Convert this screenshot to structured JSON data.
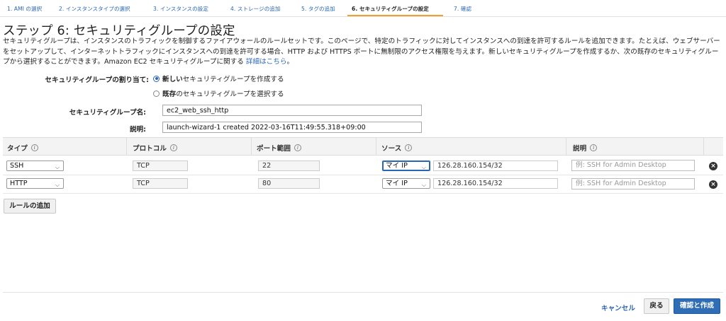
{
  "wizard": {
    "tabs": [
      {
        "label": "1. AMI の選択"
      },
      {
        "label": "2. インスタンスタイプの選択"
      },
      {
        "label": "3. インスタンスの設定"
      },
      {
        "label": "4. ストレージの追加"
      },
      {
        "label": "5. タグの追加"
      },
      {
        "label": "6. セキュリティグループの設定"
      },
      {
        "label": "7. 確認"
      }
    ],
    "active_index": 5
  },
  "page": {
    "title": "ステップ 6: セキュリティグループの設定",
    "intro": "セキュリティグループは、インスタンスのトラフィックを制御するファイアウォールのルールセットです。このページで、特定のトラフィックに対してインスタンスへの到達を許可するルールを追加できます。たとえば、ウェブサーバーをセットアップして、インターネットトラフィックにインスタンスへの到達を許可する場合、HTTP および HTTPS ポートに無制限のアクセス権限を与えます。新しいセキュリティグループを作成するか、次の既存のセキュリティグループから選択することができます。Amazon EC2 セキュリティグループに関する",
    "intro_link": "詳細はこちら",
    "intro_end": "。"
  },
  "assign": {
    "label": "セキュリティグループの割り当て:",
    "option_new_bold": "新しい",
    "option_new_rest": "セキュリティグループを作成する",
    "option_existing_bold": "既存",
    "option_existing_rest": "のセキュリティグループを選択する",
    "selected": "new"
  },
  "form": {
    "name_label": "セキュリティグループ名:",
    "name_value": "ec2_web_ssh_http",
    "desc_label": "説明:",
    "desc_value": "launch-wizard-1 created 2022-03-16T11:49:55.318+09:00"
  },
  "table": {
    "headers": {
      "type": "タイプ",
      "protocol": "プロトコル",
      "port": "ポート範囲",
      "source": "ソース",
      "description": "説明"
    },
    "info_glyph": "i",
    "rows": [
      {
        "type": "SSH",
        "protocol": "TCP",
        "port": "22",
        "source_type": "マイ IP",
        "source_value": "126.28.160.154/32",
        "description_placeholder": "例: SSH for Admin Desktop"
      },
      {
        "type": "HTTP",
        "protocol": "TCP",
        "port": "80",
        "source_type": "マイ IP",
        "source_value": "126.28.160.154/32",
        "description_placeholder": "例: SSH for Admin Desktop"
      }
    ]
  },
  "buttons": {
    "add_rule": "ルールの追加",
    "cancel": "キャンセル",
    "back": "戻る",
    "review_launch": "確認と作成"
  },
  "colors": {
    "accent": "#2a66b8",
    "primary": "#2f6db5",
    "active_tab_underline": "#f0a030"
  }
}
